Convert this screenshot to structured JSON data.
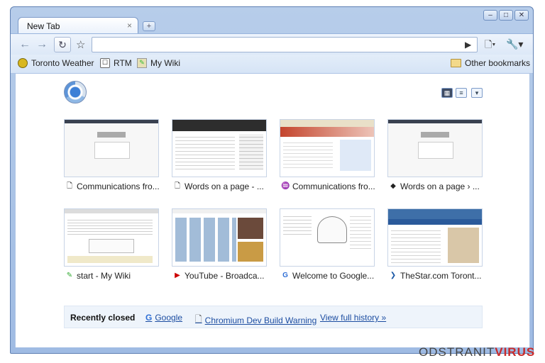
{
  "window": {
    "controls": [
      "minimize",
      "maximize",
      "close"
    ]
  },
  "tab": {
    "title": "New Tab",
    "close": "×"
  },
  "new_tab_button": "+",
  "toolbar": {
    "back": "←",
    "forward": "→",
    "reload": "↻",
    "star": "☆",
    "omnibox_value": "",
    "go": "▶",
    "page": "🗋▾",
    "tools": "🔧▾"
  },
  "bookmarks_bar": {
    "items": [
      {
        "label": "Toronto Weather",
        "icon": "weather-icon"
      },
      {
        "label": "RTM",
        "icon": "rtm-icon"
      },
      {
        "label": "My Wiki",
        "icon": "wiki-icon"
      }
    ],
    "other": {
      "label": "Other bookmarks",
      "icon": "folder-icon"
    }
  },
  "most_visited": [
    {
      "caption": "Communications fro...",
      "icon": "page-icon"
    },
    {
      "caption": "Words on a page - ...",
      "icon": "page-icon"
    },
    {
      "caption": "Communications fro...",
      "icon": "comm-icon"
    },
    {
      "caption": "Words on a page › ...",
      "icon": "dark-icon"
    },
    {
      "caption": "start - My Wiki",
      "icon": "wiki-icon"
    },
    {
      "caption": "YouTube - Broadca...",
      "icon": "youtube-icon"
    },
    {
      "caption": "Welcome to Google...",
      "icon": "google-icon"
    },
    {
      "caption": "TheStar.com Toront...",
      "icon": "star-icon"
    }
  ],
  "recently_closed": {
    "label": "Recently closed",
    "items": [
      {
        "label": "Google",
        "icon": "google-icon"
      },
      {
        "label": "Chromium Dev Build Warning",
        "icon": "page-icon"
      },
      {
        "label": "View full history »",
        "icon": ""
      }
    ]
  },
  "watermark": {
    "part1": "ODSTRANIT",
    "part2": "VIRUS"
  }
}
